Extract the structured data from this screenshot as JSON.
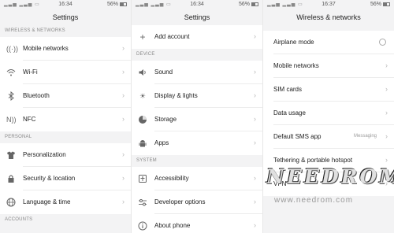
{
  "statusbar": [
    {
      "time": "16:34",
      "battery": "56%"
    },
    {
      "time": "16:34",
      "battery": "56%"
    },
    {
      "time": "16:37",
      "battery": "56%"
    }
  ],
  "panel1": {
    "title": "Settings",
    "sections": {
      "wireless": "WIRELESS & NETWORKS",
      "personal": "PERSONAL",
      "accounts": "ACCOUNTS"
    },
    "items": {
      "mobile_networks": "Mobile networks",
      "wifi": "Wi-Fi",
      "bluetooth": "Bluetooth",
      "nfc": "NFC",
      "personalization": "Personalization",
      "security": "Security & location",
      "language": "Language & time"
    }
  },
  "panel2": {
    "title": "Settings",
    "sections": {
      "device": "DEVICE",
      "system": "SYSTEM"
    },
    "items": {
      "add_account": "Add account",
      "sound": "Sound",
      "display": "Display & lights",
      "storage": "Storage",
      "apps": "Apps",
      "accessibility": "Accessibility",
      "developer": "Developer options",
      "about": "About phone"
    }
  },
  "panel3": {
    "title": "Wireless & networks",
    "items": {
      "airplane": "Airplane mode",
      "mobile_networks": "Mobile networks",
      "sim_cards": "SIM cards",
      "data_usage": "Data usage",
      "default_sms": "Default SMS app",
      "default_sms_value": "Messaging",
      "tethering": "Tethering & portable hotspot",
      "vpn": "VPN"
    }
  },
  "watermark": {
    "logo": "NEEDROM",
    "url": "www.needrom.com"
  },
  "colors": {
    "background": "#f3f3f4",
    "row": "#ffffff",
    "section_text": "#8a8a8a"
  }
}
